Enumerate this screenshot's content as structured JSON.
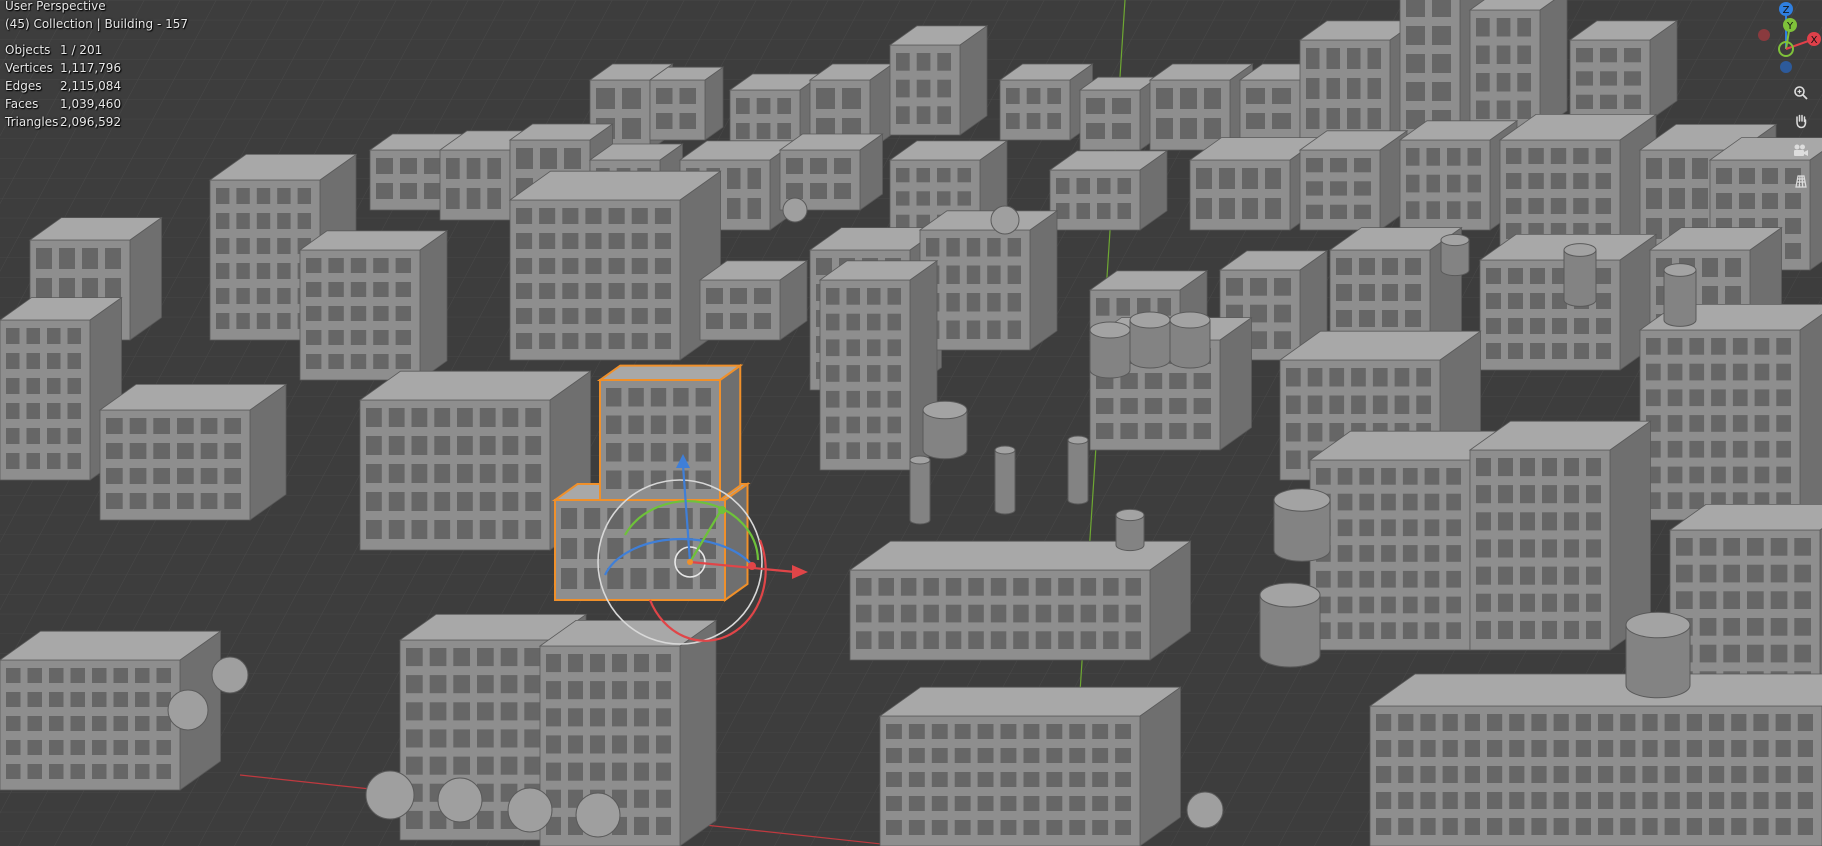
{
  "viewport": {
    "perspective": "User Perspective",
    "collection_line": "(45) Collection | Building - 157",
    "stats": [
      {
        "label": "Objects",
        "value": "1 / 201"
      },
      {
        "label": "Vertices",
        "value": "1,117,796"
      },
      {
        "label": "Edges",
        "value": "2,115,084"
      },
      {
        "label": "Faces",
        "value": "1,039,460"
      },
      {
        "label": "Triangles",
        "value": "2,096,592"
      }
    ]
  },
  "gizmo": {
    "axes": [
      {
        "label": "Z",
        "color": "#2f7fe0"
      },
      {
        "label": "Y",
        "color": "#7fc23a"
      },
      {
        "label": "X",
        "color": "#e0404a"
      }
    ]
  },
  "nav_icons": [
    "zoom-icon",
    "pan-hand-icon",
    "camera-view-icon",
    "ortho-grid-icon"
  ],
  "colors": {
    "background": "#3d3d3d",
    "building": "#8e8e8e",
    "selection": "#f0902a",
    "x_axis": "#c0393f",
    "y_axis": "#6ea832"
  }
}
